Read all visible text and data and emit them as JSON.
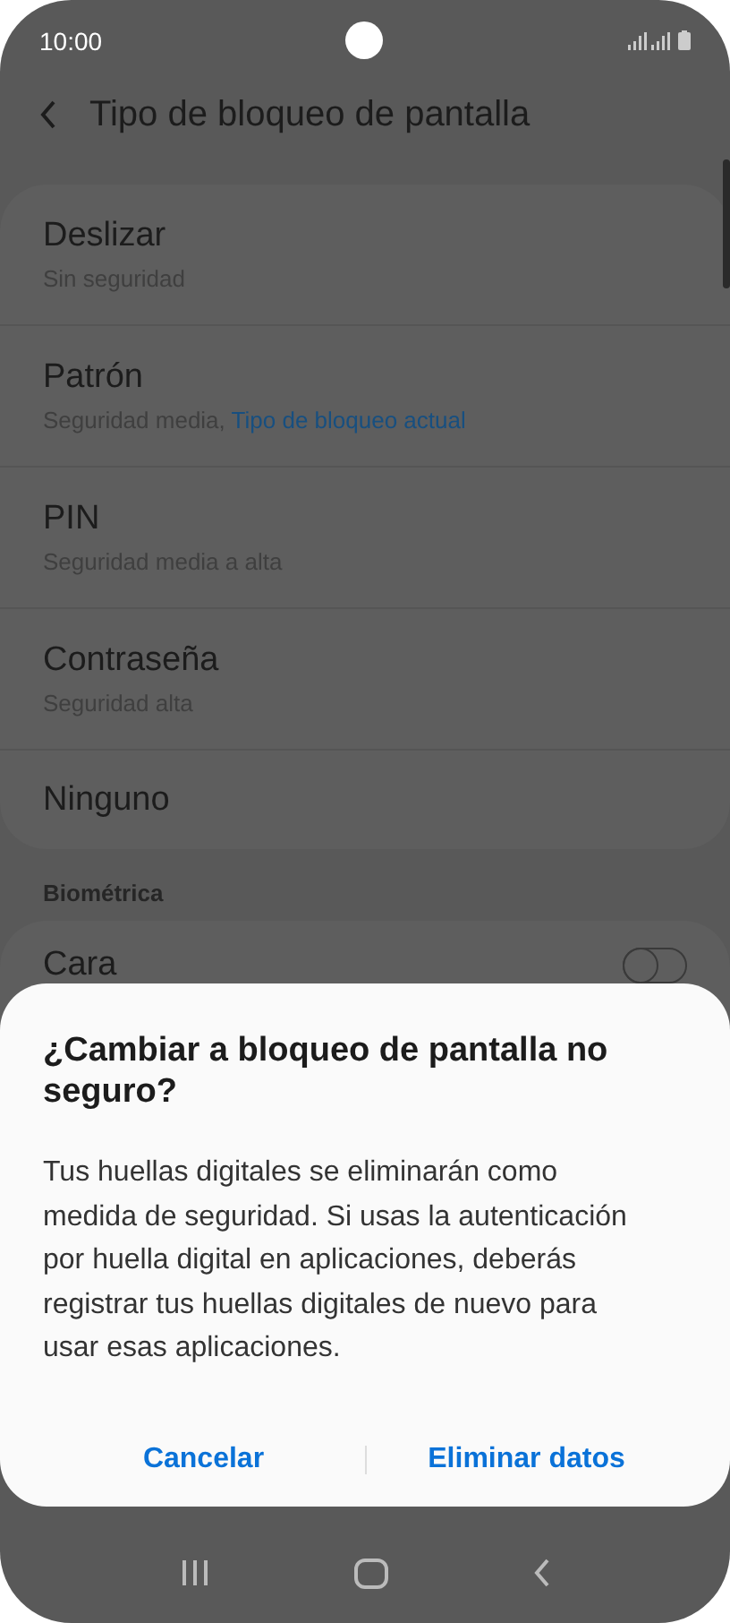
{
  "status_bar": {
    "time": "10:00"
  },
  "header": {
    "title": "Tipo de bloqueo de pantalla"
  },
  "lock_types": [
    {
      "title": "Deslizar",
      "subtitle": "Sin seguridad"
    },
    {
      "title": "Patrón",
      "subtitle": "Seguridad media,",
      "current_label": "Tipo de bloqueo actual"
    },
    {
      "title": "PIN",
      "subtitle": "Seguridad media a alta"
    },
    {
      "title": "Contraseña",
      "subtitle": "Seguridad alta"
    },
    {
      "title": "Ninguno"
    }
  ],
  "biometrics": {
    "heading": "Biométrica",
    "items": [
      {
        "title": "Cara",
        "on": false
      }
    ]
  },
  "dialog": {
    "title": "¿Cambiar a bloqueo de pantalla no seguro?",
    "message": "Tus huellas digitales se eliminarán como medida de seguridad. Si usas la autenticación por huella digital en aplicaciones, deberás registrar tus huellas digitales de nuevo para usar esas aplicaciones.",
    "buttons": [
      "Cancelar",
      "Eliminar datos"
    ]
  }
}
